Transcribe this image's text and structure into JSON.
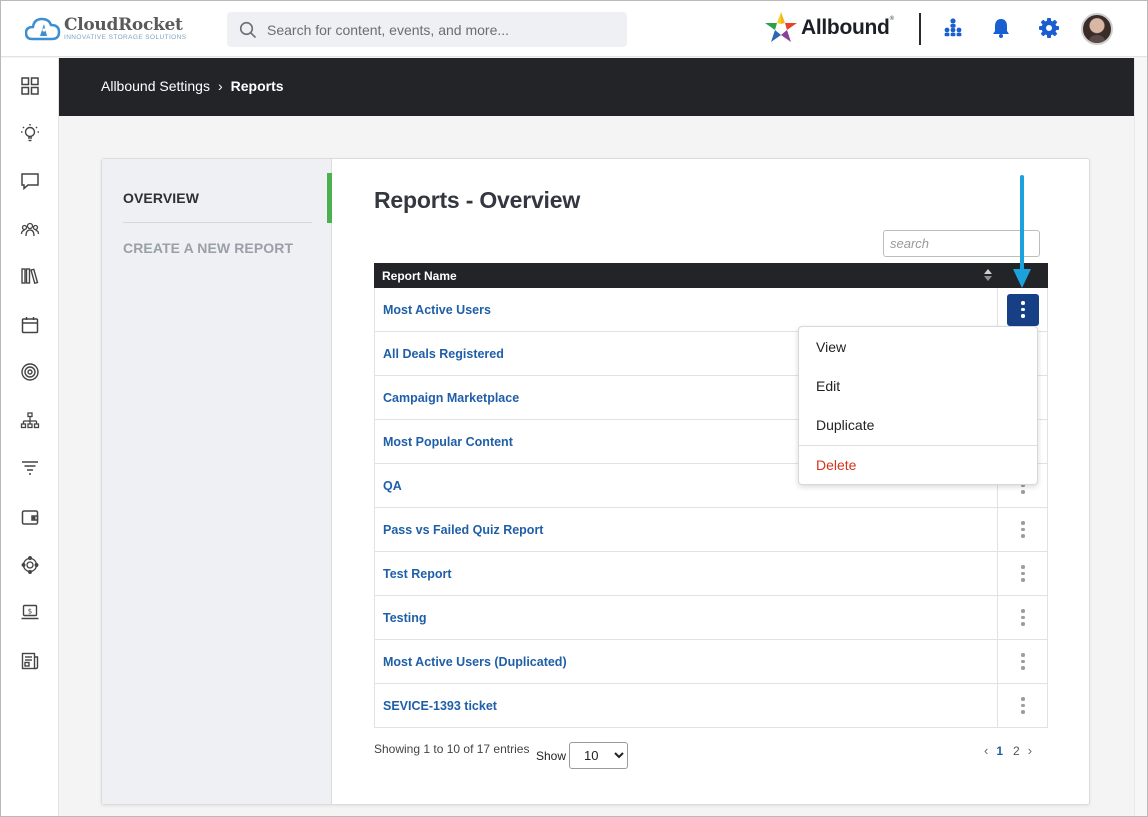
{
  "brand": {
    "name": "CloudRocket",
    "tagline": "INNOVATIVE STORAGE SOLUTIONS",
    "partner_logo": "Allbound",
    "partner_mark": "®"
  },
  "search": {
    "placeholder": "Search for content, events, and more..."
  },
  "topbar_icons": [
    "org-chart-icon",
    "bell-icon",
    "gear-icon",
    "avatar"
  ],
  "sidebar_icons": [
    "dashboard-icon",
    "lightbulb-icon",
    "chat-icon",
    "community-icon",
    "library-icon",
    "calendar-icon",
    "target-icon",
    "hierarchy-icon",
    "funnel-icon",
    "wallet-icon",
    "hub-icon",
    "laptop-dollar-icon",
    "news-icon"
  ],
  "breadcrumb": {
    "parent": "Allbound Settings",
    "separator": "›",
    "current": "Reports"
  },
  "nav": {
    "overview": "OVERVIEW",
    "create": "CREATE A NEW REPORT"
  },
  "page": {
    "title": "Reports - Overview",
    "table_search_placeholder": "search"
  },
  "table": {
    "column_header": "Report Name",
    "rows": [
      "Most Active Users",
      "All Deals Registered",
      "Campaign Marketplace",
      "Most Popular Content",
      "QA",
      "Pass vs Failed Quiz Report",
      "Test Report",
      "Testing",
      "Most Active Users (Duplicated)",
      "SEVICE-1393 ticket"
    ]
  },
  "action_menu": {
    "view": "View",
    "edit": "Edit",
    "duplicate": "Duplicate",
    "delete": "Delete"
  },
  "footer": {
    "showing": "Showing 1 to 10 of 17 entries",
    "show_label": "Show",
    "page_size": "10",
    "pages": [
      "1",
      "2"
    ],
    "current_page": "1",
    "prev": "‹",
    "next": "›"
  },
  "colors": {
    "accent_green": "#4caf50",
    "link_blue": "#1f5fa8",
    "active_kebab": "#163f86",
    "delete_red": "#d4351c",
    "arrow_blue": "#1ba1dc",
    "dark_band": "#222428"
  }
}
